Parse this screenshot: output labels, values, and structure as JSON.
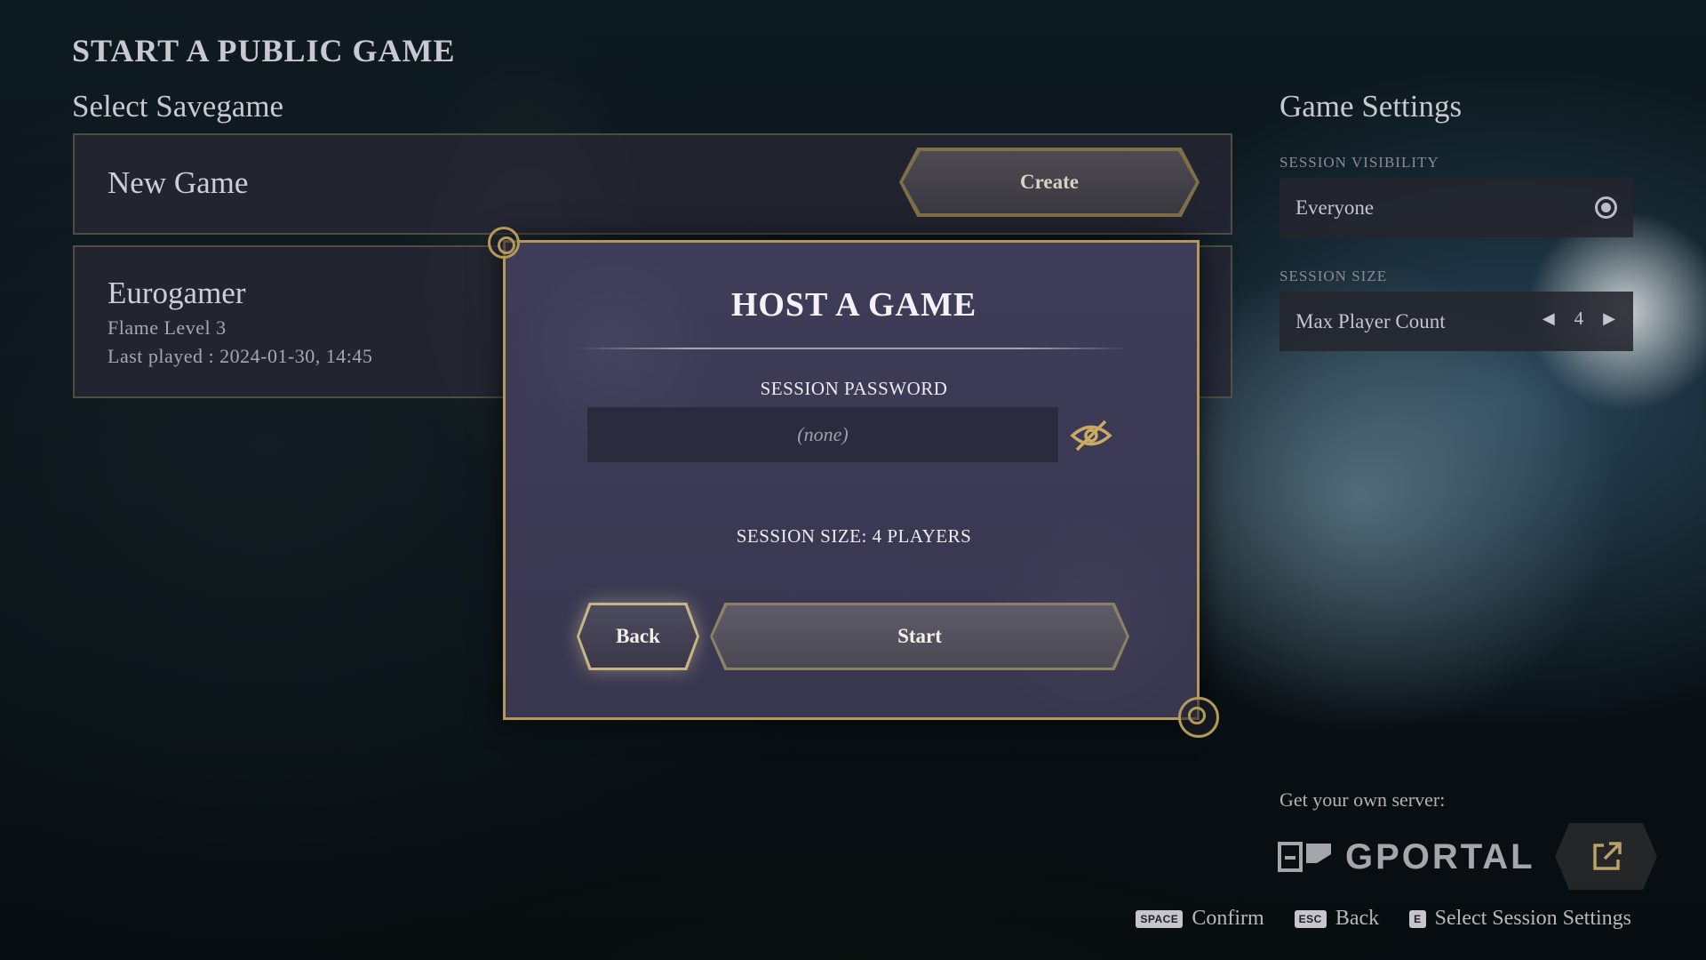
{
  "screen": {
    "title": "START A PUBLIC GAME"
  },
  "savegames": {
    "heading": "Select Savegame",
    "new_game": {
      "name": "New Game",
      "button_label": "Create"
    },
    "items": [
      {
        "name": "Eurogamer",
        "level": "Flame Level 3",
        "last_played": "Last played : 2024-01-30, 14:45"
      }
    ]
  },
  "game_settings": {
    "heading": "Game Settings",
    "session_visibility": {
      "label": "SESSION VISIBILITY",
      "value": "Everyone"
    },
    "session_size": {
      "label": "SESSION SIZE",
      "name": "Max Player Count",
      "value": "4"
    }
  },
  "server_promo": {
    "label": "Get your own server:",
    "brand": "GPORTAL"
  },
  "modal": {
    "title": "HOST A GAME",
    "password_label": "SESSION PASSWORD",
    "password_value": "",
    "password_placeholder": "(none)",
    "session_size_text": "SESSION SIZE: 4 PLAYERS",
    "back_label": "Back",
    "start_label": "Start"
  },
  "hints": [
    {
      "key": "SPACE",
      "label": "Confirm"
    },
    {
      "key": "ESC",
      "label": "Back"
    },
    {
      "key": "E",
      "label": "Select Session Settings"
    }
  ],
  "colors": {
    "gold_frame": "#b49a5a",
    "modal_bg": "#3e3c58",
    "panel_bg": "#28283a"
  }
}
